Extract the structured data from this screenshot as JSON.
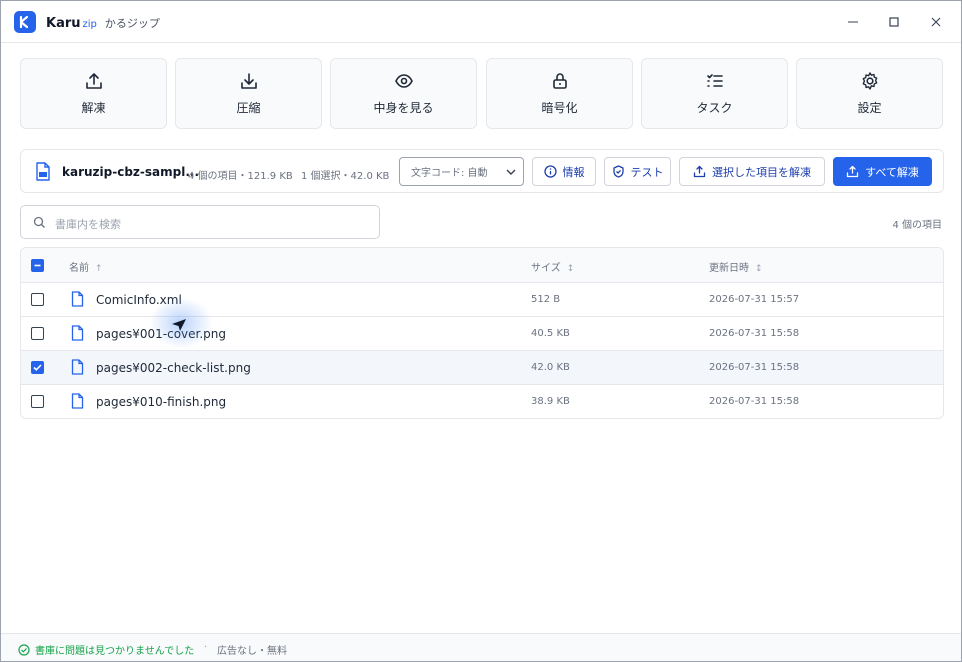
{
  "app": {
    "logo_letter": "K",
    "name": "Karu",
    "name_suffix": "zip",
    "name_jp": "かるジップ"
  },
  "window_controls": {
    "minimize": "–",
    "maximize": "□",
    "close": "×"
  },
  "toolbar": [
    {
      "label": "解凍",
      "icon": "upload-icon"
    },
    {
      "label": "圧縮",
      "icon": "download-icon"
    },
    {
      "label": "中身を見る",
      "icon": "eye-icon"
    },
    {
      "label": "暗号化",
      "icon": "lock-icon"
    },
    {
      "label": "タスク",
      "icon": "task-list-icon"
    },
    {
      "label": "設定",
      "icon": "gear-icon"
    }
  ],
  "archive": {
    "name": "karuzip-cbz-sampl...",
    "meta_count": "4 個の項目・121.9 KB",
    "meta_selected": "1 個選択・42.0 KB",
    "encoding": "文字コード: 自動"
  },
  "actions": {
    "info": "情報",
    "test": "テスト",
    "extract_selected": "選択した項目を解凍",
    "extract_all": "すべて解凍"
  },
  "search": {
    "placeholder": "書庫内を検索"
  },
  "item_count": "4 個の項目",
  "table": {
    "headers": {
      "name": "名前",
      "name_sort": "↑",
      "size": "サイズ",
      "size_sort": "↕",
      "modified": "更新日時",
      "modified_sort": "↕"
    },
    "rows": [
      {
        "name": "ComicInfo.xml",
        "size": "512 B",
        "modified": "2026-07-31 15:57",
        "checked": false
      },
      {
        "name": "pages¥001-cover.png",
        "size": "40.5 KB",
        "modified": "2026-07-31 15:58",
        "checked": false
      },
      {
        "name": "pages¥002-check-list.png",
        "size": "42.0 KB",
        "modified": "2026-07-31 15:58",
        "checked": true
      },
      {
        "name": "pages¥010-finish.png",
        "size": "38.9 KB",
        "modified": "2026-07-31 15:58",
        "checked": false
      }
    ]
  },
  "status": {
    "ok_text": "書庫に問題は見つかりませんでした",
    "separator": "·",
    "ad_text": "広告なし・無料"
  },
  "colors": {
    "accent": "#2563eb",
    "success": "#16a34a"
  }
}
